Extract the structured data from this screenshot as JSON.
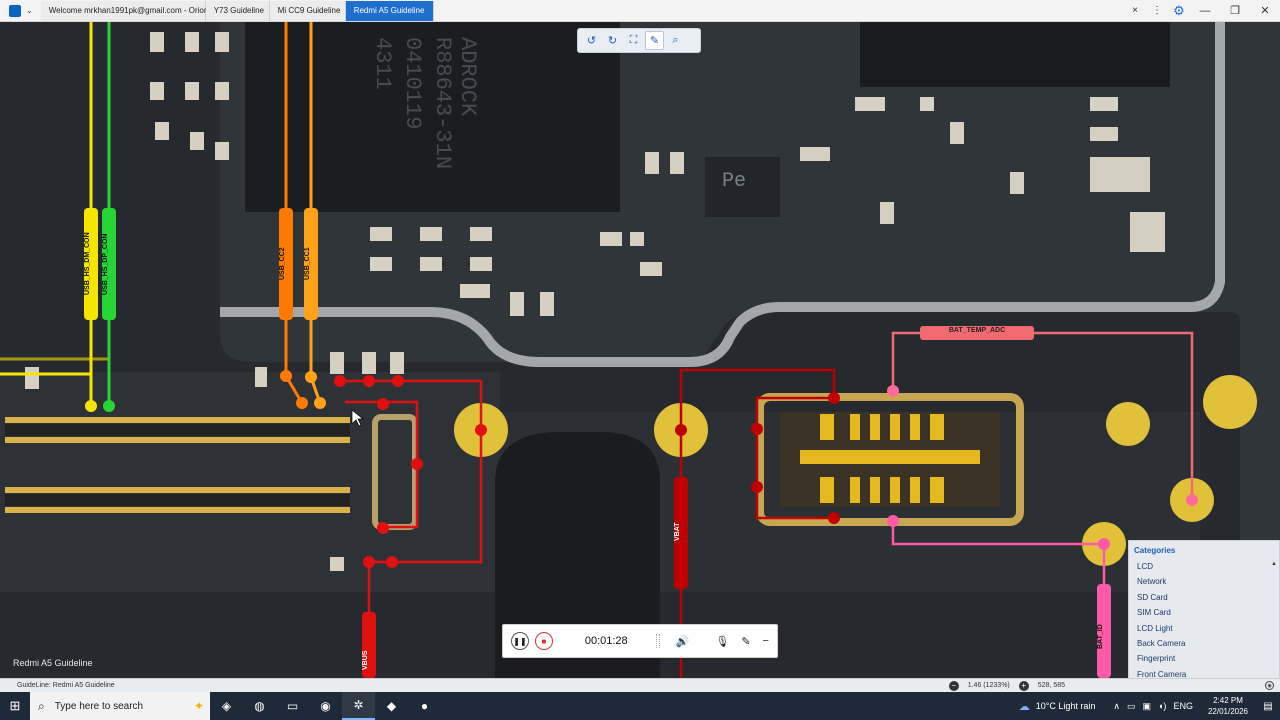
{
  "titlebar": {
    "tabs": [
      {
        "label": "Welcome mrkhan1991pk@gmail.com - Orion",
        "active": false
      },
      {
        "label": "Y73 Guideline",
        "active": false
      },
      {
        "label": "Mi CC9 Guideline",
        "active": false
      },
      {
        "label": "Redmi A5 Guideline",
        "active": true
      }
    ],
    "buttons": {
      "close_tab": "×",
      "more": "⋮",
      "settings": "⚙",
      "minimize": "—",
      "restore": "❐",
      "close": "✕"
    }
  },
  "board": {
    "net_labels": {
      "usb_hs_dm": "USB_HS_DM_CON",
      "usb_hs_dp": "USB_HS_DP_CON",
      "usb_cc2": "USB_CC2",
      "usb_cc1": "USB_CC1",
      "bat_temp": "BAT_TEMP_ADC",
      "vbat": "VBAT",
      "bat_id": "BAT_ID",
      "vbus": "VBUS"
    },
    "chip_text": [
      "ADROCK",
      "R88643-31N",
      "0410119",
      "4311"
    ],
    "pe_marking": "Pe",
    "colors": {
      "yellow": "#f4e600",
      "green": "#27d634",
      "orange": "#ff7a00",
      "orange_light": "#ffa21a",
      "red": "#e01010",
      "pink": "#ff5aa8",
      "salmon": "#f06a72",
      "darkred": "#c00000"
    }
  },
  "float_toolbar": {
    "icons": [
      "rotate-left-icon",
      "rotate-right-icon",
      "fit-screen-icon",
      "pen-icon",
      "zoom-icon"
    ]
  },
  "recorder": {
    "time": "00:01:28"
  },
  "categories": {
    "title": "Categories",
    "items": [
      "LCD",
      "Network",
      "SD Card",
      "SIM Card",
      "LCD Light",
      "Back Camera",
      "Fingerprint",
      "Front Camera"
    ]
  },
  "board_name": "Redmi A5 Guideline",
  "statusbar": {
    "guideline": "GuideLine: Redmi A5 Guideline",
    "zoom": "1.46 (1233%)",
    "coords": "528, 585"
  },
  "taskbar": {
    "search_placeholder": "Type here to search",
    "weather": "10°C  Light rain",
    "lang": "ENG",
    "time": "2:42 PM",
    "date": "22/01/2026"
  }
}
